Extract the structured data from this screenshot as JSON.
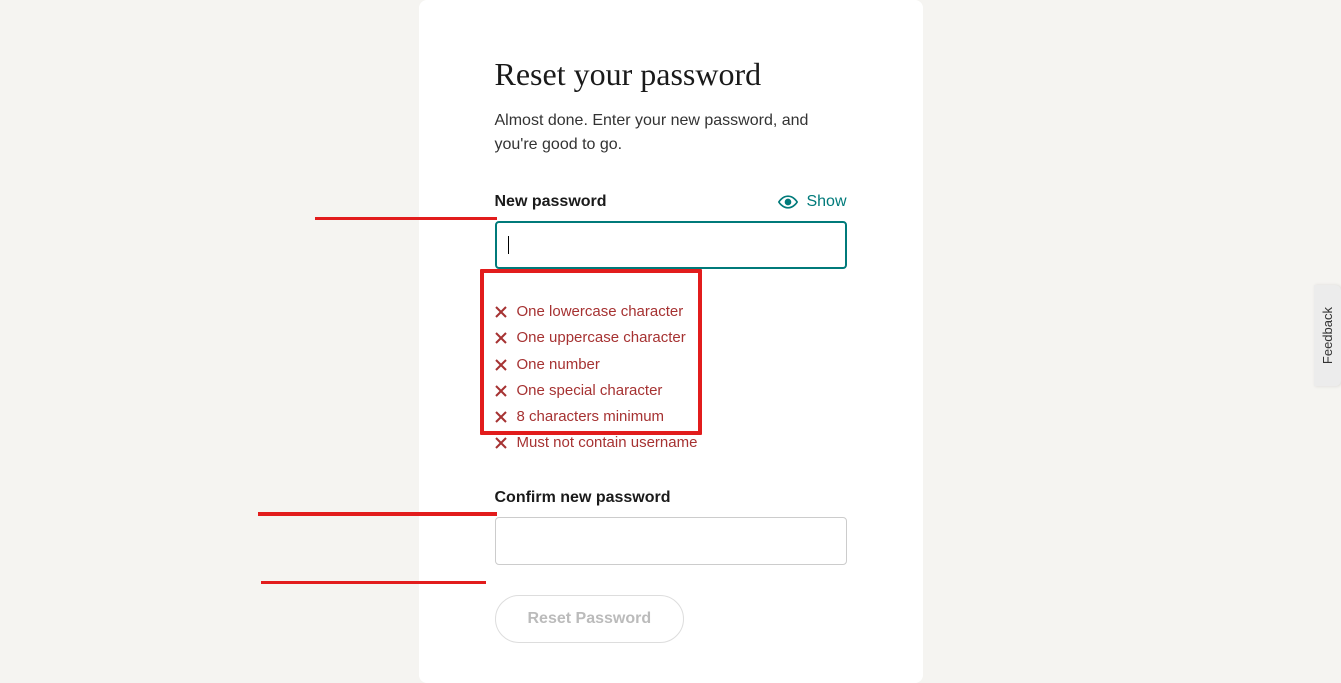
{
  "title": "Reset your password",
  "subtitle": "Almost done. Enter your new password, and you're good to go.",
  "new_password": {
    "label": "New password",
    "show_label": "Show",
    "value": ""
  },
  "rules": [
    "One lowercase character",
    "One uppercase character",
    "One number",
    "One special character",
    "8 characters minimum",
    "Must not contain username"
  ],
  "confirm_password": {
    "label": "Confirm new password",
    "value": ""
  },
  "reset_button": "Reset Password",
  "feedback": "Feedback"
}
